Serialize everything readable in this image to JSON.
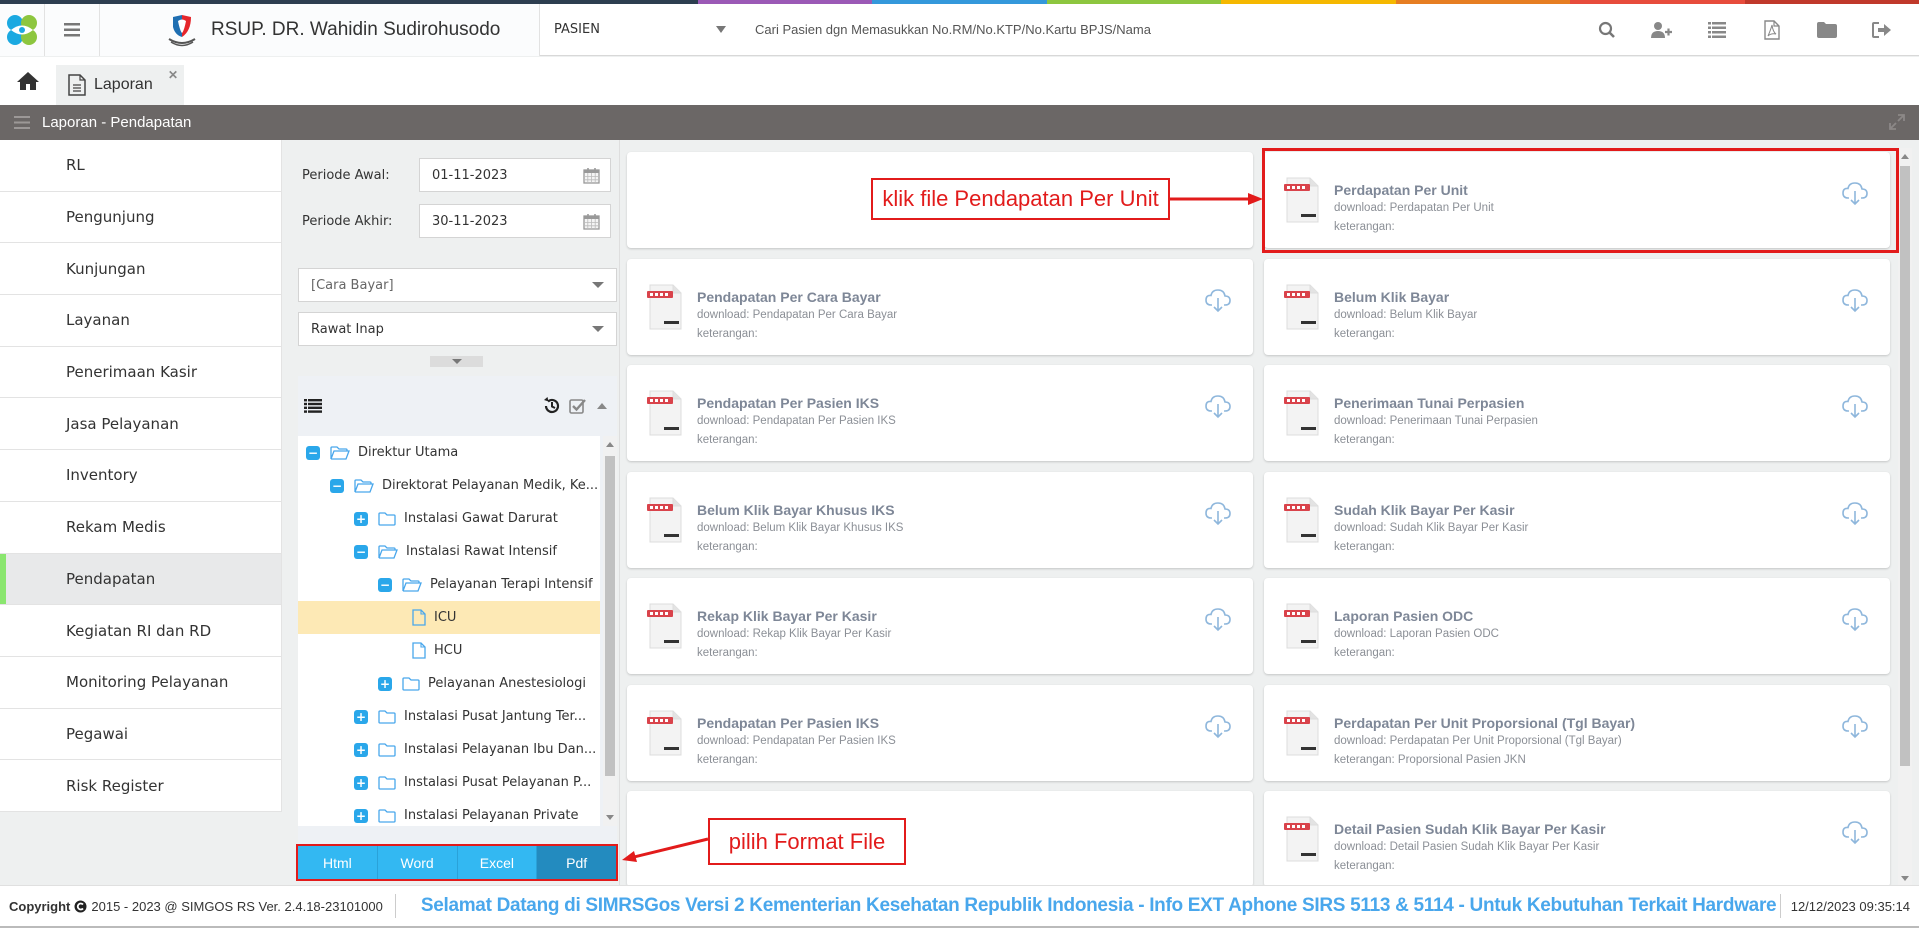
{
  "colors": {
    "topbar": [
      "#2d3e50",
      "#2d3e50",
      "#2d3e50",
      "#2d3e50",
      "#9b59b6",
      "#3498db",
      "#8dc63f",
      "#f5b800",
      "#e67e22",
      "#e74c3c",
      "#c0392b"
    ],
    "accent": "#33b8f2",
    "accent_active": "#238bbf",
    "annotation": "#e21b1b",
    "active_indicator": "#8ae66f",
    "tree_selected": "#fde9b5"
  },
  "header": {
    "hospital_name": "RSUP. DR. Wahidin Sudirohusodo",
    "search_type": "PASIEN",
    "search_placeholder": "Cari Pasien dgn Memasukkan No.RM/No.KTP/No.Kartu BPJS/Nama",
    "icons": [
      "search-icon",
      "add-user-icon",
      "list-icon",
      "pdf-file-icon",
      "folder-icon",
      "logout-icon"
    ]
  },
  "tabs": [
    {
      "label": "Laporan",
      "icon": "document-icon"
    }
  ],
  "titlebar": {
    "title": "Laporan - Pendapatan"
  },
  "sidebar": {
    "items": [
      {
        "label": "RL"
      },
      {
        "label": "Pengunjung"
      },
      {
        "label": "Kunjungan"
      },
      {
        "label": "Layanan"
      },
      {
        "label": "Penerimaan Kasir"
      },
      {
        "label": "Jasa Pelayanan"
      },
      {
        "label": "Inventory"
      },
      {
        "label": "Rekam Medis"
      },
      {
        "label": "Pendapatan",
        "active": true
      },
      {
        "label": "Kegiatan RI dan RD"
      },
      {
        "label": "Monitoring Pelayanan"
      },
      {
        "label": "Pegawai"
      },
      {
        "label": "Risk Register"
      }
    ]
  },
  "filter": {
    "periode_awal_label": "Periode Awal:",
    "periode_awal_value": "01-11-2023",
    "periode_akhir_label": "Periode Akhir:",
    "periode_akhir_value": "30-11-2023",
    "cara_bayar_placeholder": "[Cara Bayar]",
    "jenis_value": "Rawat Inap",
    "tree": [
      {
        "label": "Direktur Utama",
        "level": 0,
        "toggle": "minus",
        "type": "folder-open"
      },
      {
        "label": "Direktorat Pelayanan Medik, Ke...",
        "level": 1,
        "toggle": "minus",
        "type": "folder-open"
      },
      {
        "label": "Instalasi Gawat Darurat",
        "level": 2,
        "toggle": "plus",
        "type": "folder"
      },
      {
        "label": "Instalasi Rawat Intensif",
        "level": 2,
        "toggle": "minus",
        "type": "folder-open"
      },
      {
        "label": "Pelayanan Terapi Intensif",
        "level": 3,
        "toggle": "minus",
        "type": "folder-open"
      },
      {
        "label": "ICU",
        "level": 4,
        "toggle": "",
        "type": "file",
        "selected": true
      },
      {
        "label": "HCU",
        "level": 4,
        "toggle": "",
        "type": "file"
      },
      {
        "label": "Pelayanan Anestesiologi",
        "level": 3,
        "toggle": "plus",
        "type": "folder"
      },
      {
        "label": "Instalasi Pusat Jantung Ter...",
        "level": 2,
        "toggle": "plus",
        "type": "folder"
      },
      {
        "label": "Instalasi Pelayanan Ibu Dan...",
        "level": 2,
        "toggle": "plus",
        "type": "folder"
      },
      {
        "label": "Instalasi Pusat Pelayanan P...",
        "level": 2,
        "toggle": "plus",
        "type": "folder"
      },
      {
        "label": "Instalasi Pelayanan Private",
        "level": 2,
        "toggle": "plus",
        "type": "folder"
      }
    ],
    "formats": [
      {
        "label": "Html"
      },
      {
        "label": "Word"
      },
      {
        "label": "Excel"
      },
      {
        "label": "Pdf",
        "active": true
      }
    ]
  },
  "reports": [
    {
      "title": "",
      "download": "",
      "keterangan": "",
      "empty": true
    },
    {
      "title": "Perdapatan Per Unit",
      "download": "download: Perdapatan Per Unit",
      "keterangan": "keterangan:",
      "highlighted": true
    },
    {
      "title": "Pendapatan Per Cara Bayar",
      "download": "download: Pendapatan Per Cara Bayar",
      "keterangan": "keterangan:"
    },
    {
      "title": "Belum Klik Bayar",
      "download": "download: Belum Klik Bayar",
      "keterangan": "keterangan:"
    },
    {
      "title": "Pendapatan Per Pasien IKS",
      "download": "download: Pendapatan Per Pasien IKS",
      "keterangan": "keterangan:"
    },
    {
      "title": "Penerimaan Tunai Perpasien",
      "download": "download: Penerimaan Tunai Perpasien",
      "keterangan": "keterangan:"
    },
    {
      "title": "Belum Klik Bayar Khusus IKS",
      "download": "download: Belum Klik Bayar Khusus IKS",
      "keterangan": "keterangan:"
    },
    {
      "title": "Sudah Klik Bayar Per Kasir",
      "download": "download: Sudah Klik Bayar Per Kasir",
      "keterangan": "keterangan:"
    },
    {
      "title": "Rekap Klik Bayar Per Kasir",
      "download": "download: Rekap Klik Bayar Per Kasir",
      "keterangan": "keterangan:"
    },
    {
      "title": "Laporan Pasien ODC",
      "download": "download: Laporan Pasien ODC",
      "keterangan": "keterangan:"
    },
    {
      "title": "Pendapatan Per Pasien IKS",
      "download": "download: Pendapatan Per Pasien IKS",
      "keterangan": "keterangan:"
    },
    {
      "title": "Perdapatan Per Unit Proporsional (Tgl Bayar)",
      "download": "download: Perdapatan Per Unit Proporsional (Tgl Bayar)",
      "keterangan": "keterangan: Proporsional Pasien JKN"
    },
    {
      "title": "",
      "download": "",
      "keterangan": "",
      "empty": true
    },
    {
      "title": "Detail Pasien Sudah Klik Bayar Per Kasir",
      "download": "download: Detail Pasien Sudah Klik Bayar Per Kasir",
      "keterangan": "keterangan:"
    }
  ],
  "annotations": {
    "click_file": "klik file Pendapatan Per Unit",
    "choose_format": "pilih Format File"
  },
  "footer": {
    "copyright": "Copyright",
    "copyright_rest": "2015 - 2023 @ SIMGOS RS Ver. 2.4.18-23101000",
    "marquee": "Selamat Datang di SIMRSGos Versi 2 Kementerian Kesehatan Republik Indonesia - Info EXT Aphone SIRS 5113 & 5114 - Untuk Kebutuhan Terkait Hardware",
    "datetime": "12/12/2023 09:35:14"
  }
}
